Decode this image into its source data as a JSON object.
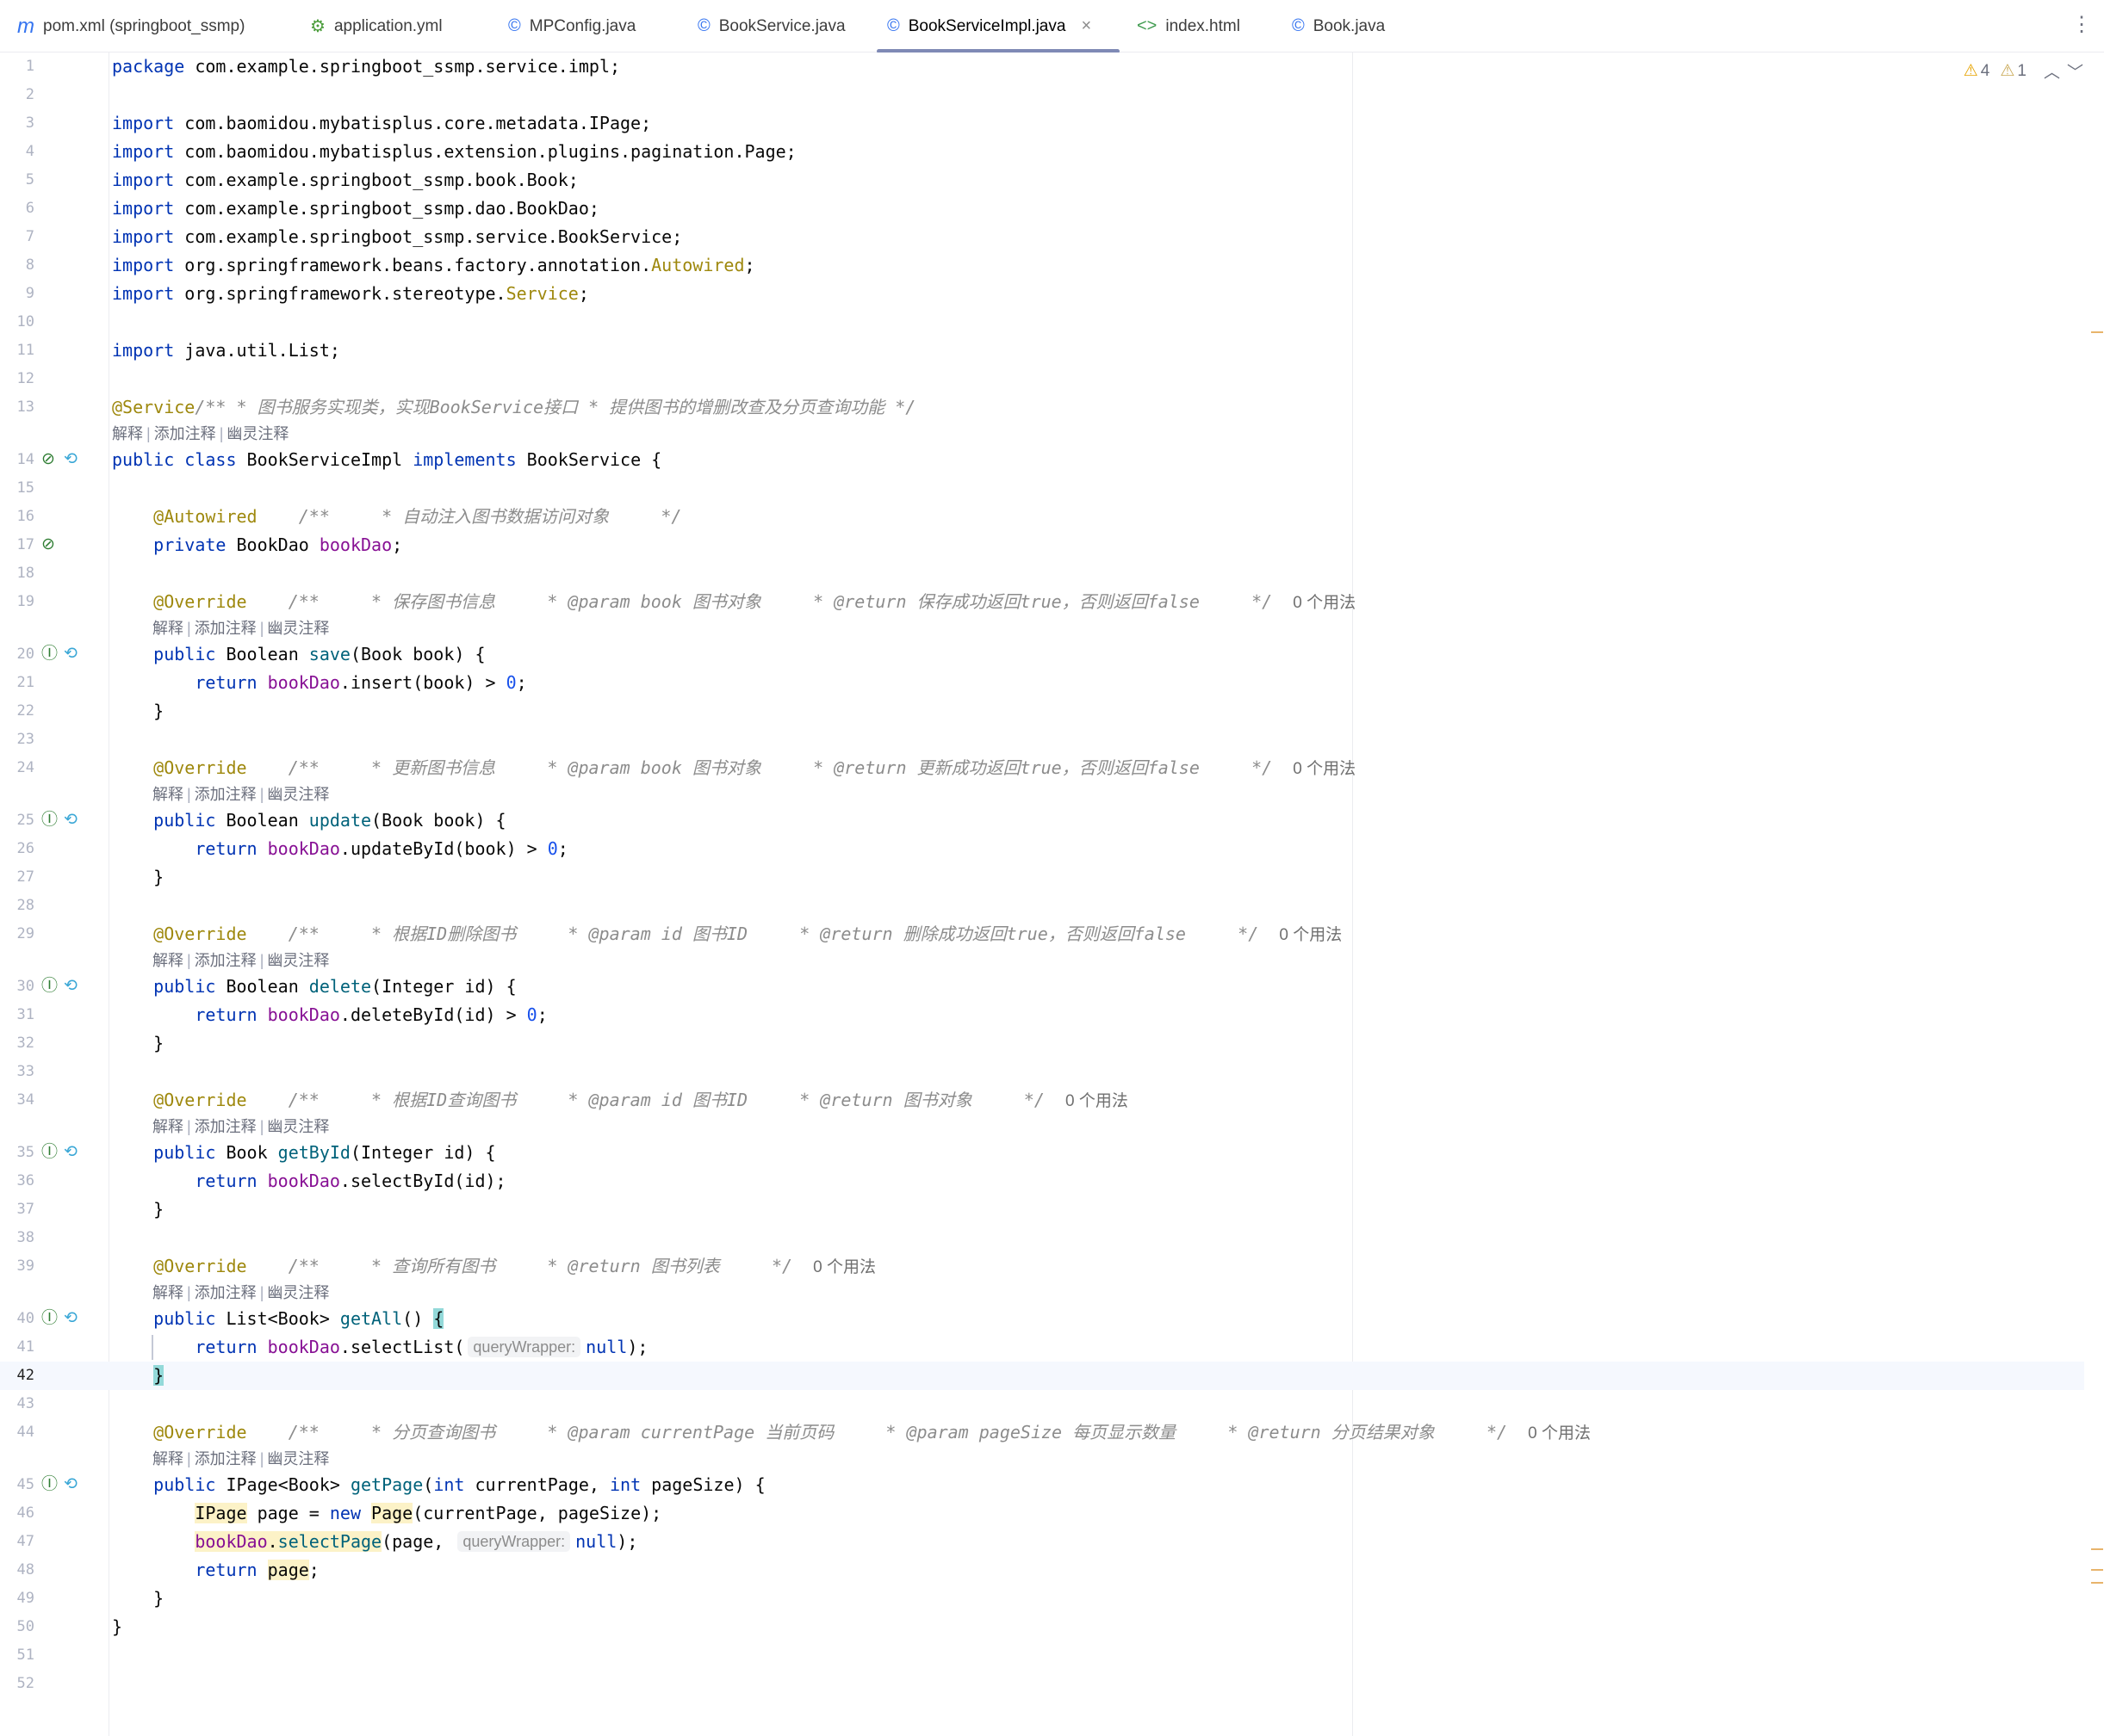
{
  "tabs": [
    {
      "label": "pom.xml (springboot_ssmp)",
      "icon": "maven-icon",
      "glyph": "m",
      "color": "#3574f0",
      "active": false
    },
    {
      "label": "application.yml",
      "icon": "yaml-icon",
      "glyph": "⚙",
      "color": "#4a9c3a",
      "active": false
    },
    {
      "label": "MPConfig.java",
      "icon": "class-icon",
      "glyph": "©",
      "color": "#3574f0",
      "active": false
    },
    {
      "label": "BookService.java",
      "icon": "class-icon",
      "glyph": "©",
      "color": "#3574f0",
      "active": false
    },
    {
      "label": "BookServiceImpl.java",
      "icon": "class-icon",
      "glyph": "©",
      "color": "#3574f0",
      "active": true
    },
    {
      "label": "index.html",
      "icon": "html-icon",
      "glyph": "<>",
      "color": "#3f9b4f",
      "active": false
    },
    {
      "label": "Book.java",
      "icon": "class-icon",
      "glyph": "©",
      "color": "#3574f0",
      "active": false
    }
  ],
  "inspection": {
    "warnings": "4",
    "weak_warnings": "1"
  },
  "lens": {
    "explain": "解释",
    "add_comment": "添加注释",
    "ghost_comment": "幽灵注释"
  },
  "hints": {
    "query_wrapper": "queryWrapper:"
  },
  "usages": "0 个用法",
  "caret_line": 42,
  "lines": [
    {
      "n": 1,
      "html": "<span class='kw'>package</span> com.example.springboot_ssmp.service.impl;"
    },
    {
      "n": 2,
      "html": ""
    },
    {
      "n": 3,
      "html": "<span class='kw'>import</span> com.baomidou.mybatisplus.core.metadata.IPage;"
    },
    {
      "n": 4,
      "html": "<span class='kw'>import</span> com.baomidou.mybatisplus.extension.plugins.pagination.Page;"
    },
    {
      "n": 5,
      "html": "<span class='kw'>import</span> com.example.springboot_ssmp.book.Book;"
    },
    {
      "n": 6,
      "html": "<span class='kw'>import</span> com.example.springboot_ssmp.dao.BookDao;"
    },
    {
      "n": 7,
      "html": "<span class='kw'>import</span> com.example.springboot_ssmp.service.BookService;"
    },
    {
      "n": 8,
      "html": "<span class='kw'>import</span> org.springframework.beans.factory.annotation.<span class='an'>Autowired</span>;"
    },
    {
      "n": 9,
      "html": "<span class='kw'>import</span> org.springframework.stereotype.<span class='an'>Service</span>;"
    },
    {
      "n": 10,
      "html": ""
    },
    {
      "n": 11,
      "html": "<span class='kw'>import</span> java.util.List;"
    },
    {
      "n": 12,
      "html": ""
    },
    {
      "n": 13,
      "html": "<span class='an'>@Service</span><span class='cm'>/** * 图书服务实现类，实现BookService接口 * 提供图书的增删改查及分页查询功能 */</span>"
    },
    {
      "n": 14,
      "lens": 1,
      "gi": [
        "run",
        "link"
      ],
      "html": "<span class='kw'>public class</span> BookServiceImpl <span class='kw'>implements</span> BookService {"
    },
    {
      "n": 15,
      "html": ""
    },
    {
      "n": 16,
      "html": "    <span class='an'>@Autowired</span>    <span class='cm'>/**     * 自动注入图书数据访问对象     */</span>"
    },
    {
      "n": 17,
      "gi": [
        "run"
      ],
      "html": "    <span class='kw'>private</span> BookDao <span class='fld'>bookDao</span>;"
    },
    {
      "n": 18,
      "html": ""
    },
    {
      "n": 19,
      "usages": 1,
      "html": "    <span class='an'>@Override</span>    <span class='cm'>/**     * 保存图书信息     * @param book 图书对象     * @return 保存成功返回true，否则返回false     */</span>  "
    },
    {
      "n": 20,
      "lens": 5,
      "gi": [
        "impl",
        "link"
      ],
      "html": "    <span class='kw'>public</span> Boolean <span class='mth'>save</span>(Book book) {"
    },
    {
      "n": 21,
      "html": "        <span class='kw'>return</span> <span class='fld'>bookDao</span>.insert(book) &gt; <span class='num'>0</span>;"
    },
    {
      "n": 22,
      "html": "    }"
    },
    {
      "n": 23,
      "html": ""
    },
    {
      "n": 24,
      "usages": 1,
      "html": "    <span class='an'>@Override</span>    <span class='cm'>/**     * 更新图书信息     * @param book 图书对象     * @return 更新成功返回true，否则返回false     */</span>  "
    },
    {
      "n": 25,
      "lens": 5,
      "gi": [
        "impl",
        "link"
      ],
      "html": "    <span class='kw'>public</span> Boolean <span class='mth'>update</span>(Book book) {"
    },
    {
      "n": 26,
      "html": "        <span class='kw'>return</span> <span class='fld'>bookDao</span>.updateById(book) &gt; <span class='num'>0</span>;"
    },
    {
      "n": 27,
      "html": "    }"
    },
    {
      "n": 28,
      "html": ""
    },
    {
      "n": 29,
      "usages": 1,
      "html": "    <span class='an'>@Override</span>    <span class='cm'>/**     * 根据ID删除图书     * @param id 图书ID     * @return 删除成功返回true，否则返回false     */</span>  "
    },
    {
      "n": 30,
      "lens": 5,
      "gi": [
        "impl",
        "link"
      ],
      "html": "    <span class='kw'>public</span> Boolean <span class='mth'>delete</span>(Integer id) {"
    },
    {
      "n": 31,
      "html": "        <span class='kw'>return</span> <span class='fld'>bookDao</span>.deleteById(id) &gt; <span class='num'>0</span>;"
    },
    {
      "n": 32,
      "html": "    }"
    },
    {
      "n": 33,
      "html": ""
    },
    {
      "n": 34,
      "usages": 1,
      "html": "    <span class='an'>@Override</span>    <span class='cm'>/**     * 根据ID查询图书     * @param id 图书ID     * @return 图书对象     */</span>  "
    },
    {
      "n": 35,
      "lens": 5,
      "gi": [
        "impl",
        "link"
      ],
      "html": "    <span class='kw'>public</span> Book <span class='mth'>getById</span>(Integer id) {"
    },
    {
      "n": 36,
      "html": "        <span class='kw'>return</span> <span class='fld'>bookDao</span>.selectById(id);"
    },
    {
      "n": 37,
      "html": "    }"
    },
    {
      "n": 38,
      "html": ""
    },
    {
      "n": 39,
      "usages": 1,
      "html": "    <span class='an'>@Override</span>    <span class='cm'>/**     * 查询所有图书     * @return 图书列表     */</span>  "
    },
    {
      "n": 40,
      "lens": 5,
      "gi": [
        "impl",
        "link"
      ],
      "html": "    <span class='kw'>public</span> List&lt;Book&gt; <span class='mth'>getAll</span>() <span class='brace-hl'>{</span>"
    },
    {
      "n": 41,
      "hint": 1,
      "html": "        <span class='kw'>return</span> <span class='fld'>bookDao</span>.selectList(<span class='hint'>queryWrapper:</span><span class='kw'>null</span>);"
    },
    {
      "n": 42,
      "html": "    <span class='brace-hl'>}</span>"
    },
    {
      "n": 43,
      "html": ""
    },
    {
      "n": 44,
      "usages": 1,
      "html": "    <span class='an'>@Override</span>    <span class='cm'>/**     * 分页查询图书     * @param currentPage 当前页码     * @param pageSize 每页显示数量     * @return 分页结果对象     */</span>  "
    },
    {
      "n": 45,
      "lens": 5,
      "gi": [
        "impl",
        "link"
      ],
      "html": "    <span class='kw'>public</span> IPage&lt;Book&gt; <span class='mth'>getPage</span>(<span class='kw'>int</span> currentPage, <span class='kw'>int</span> pageSize) {"
    },
    {
      "n": 46,
      "html": "        <span class='hl-y'>IPage</span> page = <span class='kw'>new</span> <span class='hl-y'>Page</span>(currentPage, pageSize);"
    },
    {
      "n": 47,
      "hint": 1,
      "html": "        <span class='hl-y'><span class='fld'>bookDao</span>.<span class='mth'>selectPage</span></span>(page, <span class='hint'>queryWrapper:</span><span class='kw'>null</span>);"
    },
    {
      "n": 48,
      "html": "        <span class='kw'>return</span> <span class='hl-y'>page</span>;"
    },
    {
      "n": 49,
      "html": "    }"
    },
    {
      "n": 50,
      "html": "}"
    },
    {
      "n": 51,
      "html": ""
    },
    {
      "n": 52,
      "html": ""
    }
  ]
}
